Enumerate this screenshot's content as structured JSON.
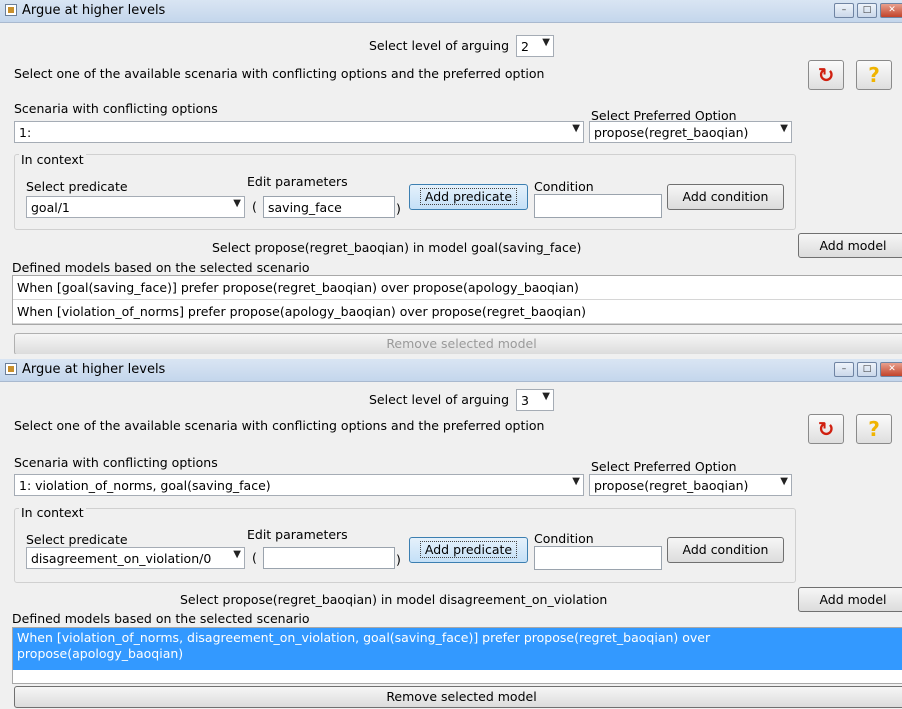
{
  "windows": [
    {
      "title": "Argue at higher levels",
      "level_label": "Select level of arguing",
      "level_value": "2",
      "instruction": "Select one of the available scenaria with conflicting options and the preferred option",
      "scenaria_label": "Scenaria with conflicting options",
      "scenario_value": "1:",
      "preferred_label": "Select Preferred Option",
      "preferred_value": "propose(regret_baoqian)",
      "context_label": "In context",
      "predicate_label": "Select predicate",
      "predicate_value": "goal/1",
      "params_label": "Edit parameters",
      "paren_open": "(",
      "paren_close": ")",
      "params_value": "saving_face",
      "add_predicate": "Add predicate",
      "condition_label": "Condition",
      "condition_value": "",
      "add_condition": "Add condition",
      "select_model_text": "Select propose(regret_baoqian) in model goal(saving_face)",
      "add_model": "Add model",
      "defined_label": "Defined models based on the selected scenario",
      "models": [
        "When [goal(saving_face)] prefer propose(regret_baoqian) over propose(apology_baoqian)",
        "When [violation_of_norms] prefer propose(apology_baoqian) over propose(regret_baoqian)"
      ],
      "remove_model": "Remove selected model",
      "help_glyph": "?",
      "reset_glyph": "↻"
    },
    {
      "title": "Argue at higher levels",
      "level_label": "Select level of arguing",
      "level_value": "3",
      "instruction": "Select one of the available scenaria with conflicting options and the preferred option",
      "scenaria_label": "Scenaria with conflicting options",
      "scenario_value": "1: violation_of_norms, goal(saving_face)",
      "preferred_label": "Select Preferred Option",
      "preferred_value": "propose(regret_baoqian)",
      "context_label": "In context",
      "predicate_label": "Select predicate",
      "predicate_value": "disagreement_on_violation/0",
      "params_label": "Edit parameters",
      "paren_open": "(",
      "paren_close": ")",
      "params_value": "",
      "add_predicate": "Add predicate",
      "condition_label": "Condition",
      "condition_value": "",
      "add_condition": "Add condition",
      "select_model_text": "Select propose(regret_baoqian) in model disagreement_on_violation",
      "add_model": "Add model",
      "defined_label": "Defined models based on the selected scenario",
      "models": [
        "When [violation_of_norms, disagreement_on_violation, goal(saving_face)] prefer propose(regret_baoqian) over propose(apology_baoqian)"
      ],
      "remove_model": "Remove selected model",
      "help_glyph": "?",
      "reset_glyph": "↻"
    }
  ],
  "icons": {
    "reset": "refresh-icon",
    "help": "help-icon",
    "app": "java-app-icon"
  },
  "colors": {
    "selection": "#3399ff",
    "help_icon": "#f0b400",
    "reset_icon": "#d02010",
    "titlebar": "#c4d6ec"
  }
}
